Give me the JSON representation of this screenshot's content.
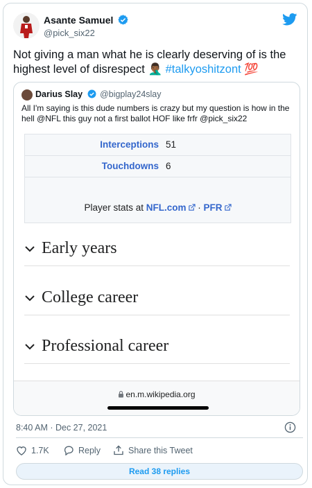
{
  "author": {
    "name": "Asante Samuel",
    "handle": "@pick_six22"
  },
  "tweet": {
    "text": "Not giving a man what he is clearly deserving of is the highest level of disrespect",
    "emoji1": "🤦🏾‍♂️",
    "hashtag": "#talkyoshitzont",
    "emoji2": "💯"
  },
  "quote": {
    "name": "Darius Slay",
    "handle": "@bigplay24slay",
    "text": "All I'm saying is this dude numbers is crazy but my question is how in the hell @NFL this guy not a first ballot HOF like frfr @pick_six22",
    "stats": [
      {
        "label": "Interceptions",
        "value": "51"
      },
      {
        "label": "Touchdowns",
        "value": "6"
      }
    ],
    "player_stats_prefix": "Player stats at",
    "link1": "NFL.com",
    "separator": "·",
    "link2": "PFR",
    "sections": [
      "Early years",
      "College career",
      "Professional career"
    ],
    "url": "en.m.wikipedia.org"
  },
  "meta": {
    "timestamp": "8:40 AM · Dec 27, 2021"
  },
  "actions": {
    "likes": "1.7K",
    "reply": "Reply",
    "share": "Share this Tweet",
    "read_replies": "Read 38 replies"
  },
  "colors": {
    "accent": "#1d9bf0",
    "wiki_link": "#3366cc",
    "verified": "#1d9bf0"
  }
}
